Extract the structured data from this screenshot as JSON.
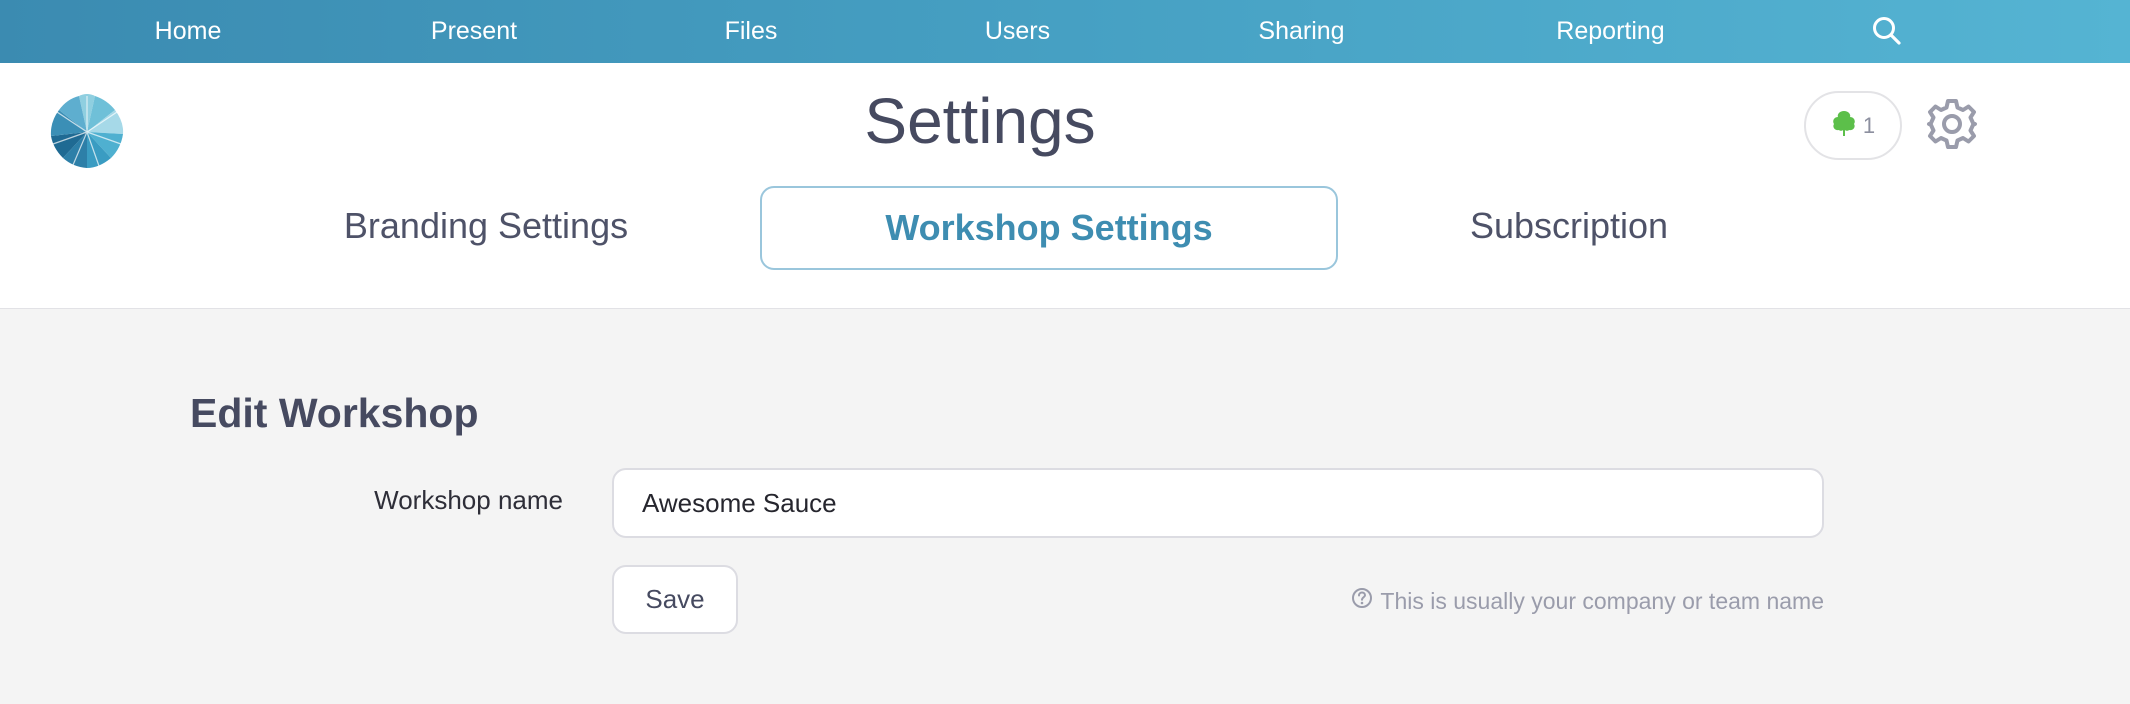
{
  "nav": {
    "items": [
      {
        "label": "Home"
      },
      {
        "label": "Present"
      },
      {
        "label": "Files"
      },
      {
        "label": "Users"
      },
      {
        "label": "Sharing"
      },
      {
        "label": "Reporting"
      }
    ],
    "search_icon": "search-icon"
  },
  "header": {
    "title": "Settings",
    "badge_count": "1",
    "badge_icon": "tree-icon",
    "settings_icon": "gear-icon"
  },
  "tabs": [
    {
      "label": "Branding Settings",
      "active": false
    },
    {
      "label": "Workshop Settings",
      "active": true
    },
    {
      "label": "Subscription",
      "active": false
    }
  ],
  "form": {
    "section_title": "Edit Workshop",
    "name_label": "Workshop name",
    "name_value": "Awesome Sauce",
    "save_label": "Save",
    "hint_text": "This is usually your company or team name",
    "hint_icon": "question-circle-icon"
  },
  "colors": {
    "nav_gradient_start": "#3b8bb1",
    "nav_gradient_end": "#55b4d3",
    "active_tab": "#3e8db1",
    "badge_icon": "#5cbf4a"
  }
}
